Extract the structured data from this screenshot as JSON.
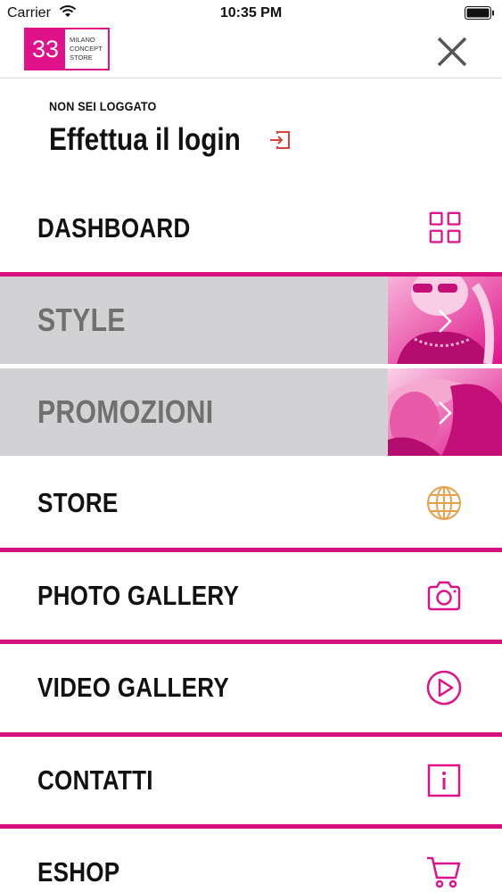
{
  "status_bar": {
    "carrier": "Carrier",
    "time": "10:35 PM"
  },
  "header": {
    "logo_number": "33",
    "logo_line1": "MILANO",
    "logo_line2": "CONCEPT",
    "logo_line3": "STORE"
  },
  "login": {
    "subtitle": "NON SEI LOGGATO",
    "title": "Effettua il login"
  },
  "menu": {
    "items": [
      {
        "label": "DASHBOARD",
        "icon": "grid-icon"
      },
      {
        "label": "STYLE",
        "icon": "chevron-right-icon"
      },
      {
        "label": "PROMOZIONI",
        "icon": "chevron-right-icon"
      },
      {
        "label": "STORE",
        "icon": "globe-icon"
      },
      {
        "label": "PHOTO GALLERY",
        "icon": "camera-icon"
      },
      {
        "label": "VIDEO GALLERY",
        "icon": "play-circle-icon"
      },
      {
        "label": "CONTATTI",
        "icon": "info-icon"
      },
      {
        "label": "ESHOP",
        "icon": "cart-icon"
      }
    ]
  },
  "colors": {
    "accent": "#e0128a",
    "separator": "#d6117f",
    "gray_row": "#d2d2d4",
    "store_icon": "#e8a04a",
    "login_icon": "#e0403a"
  }
}
